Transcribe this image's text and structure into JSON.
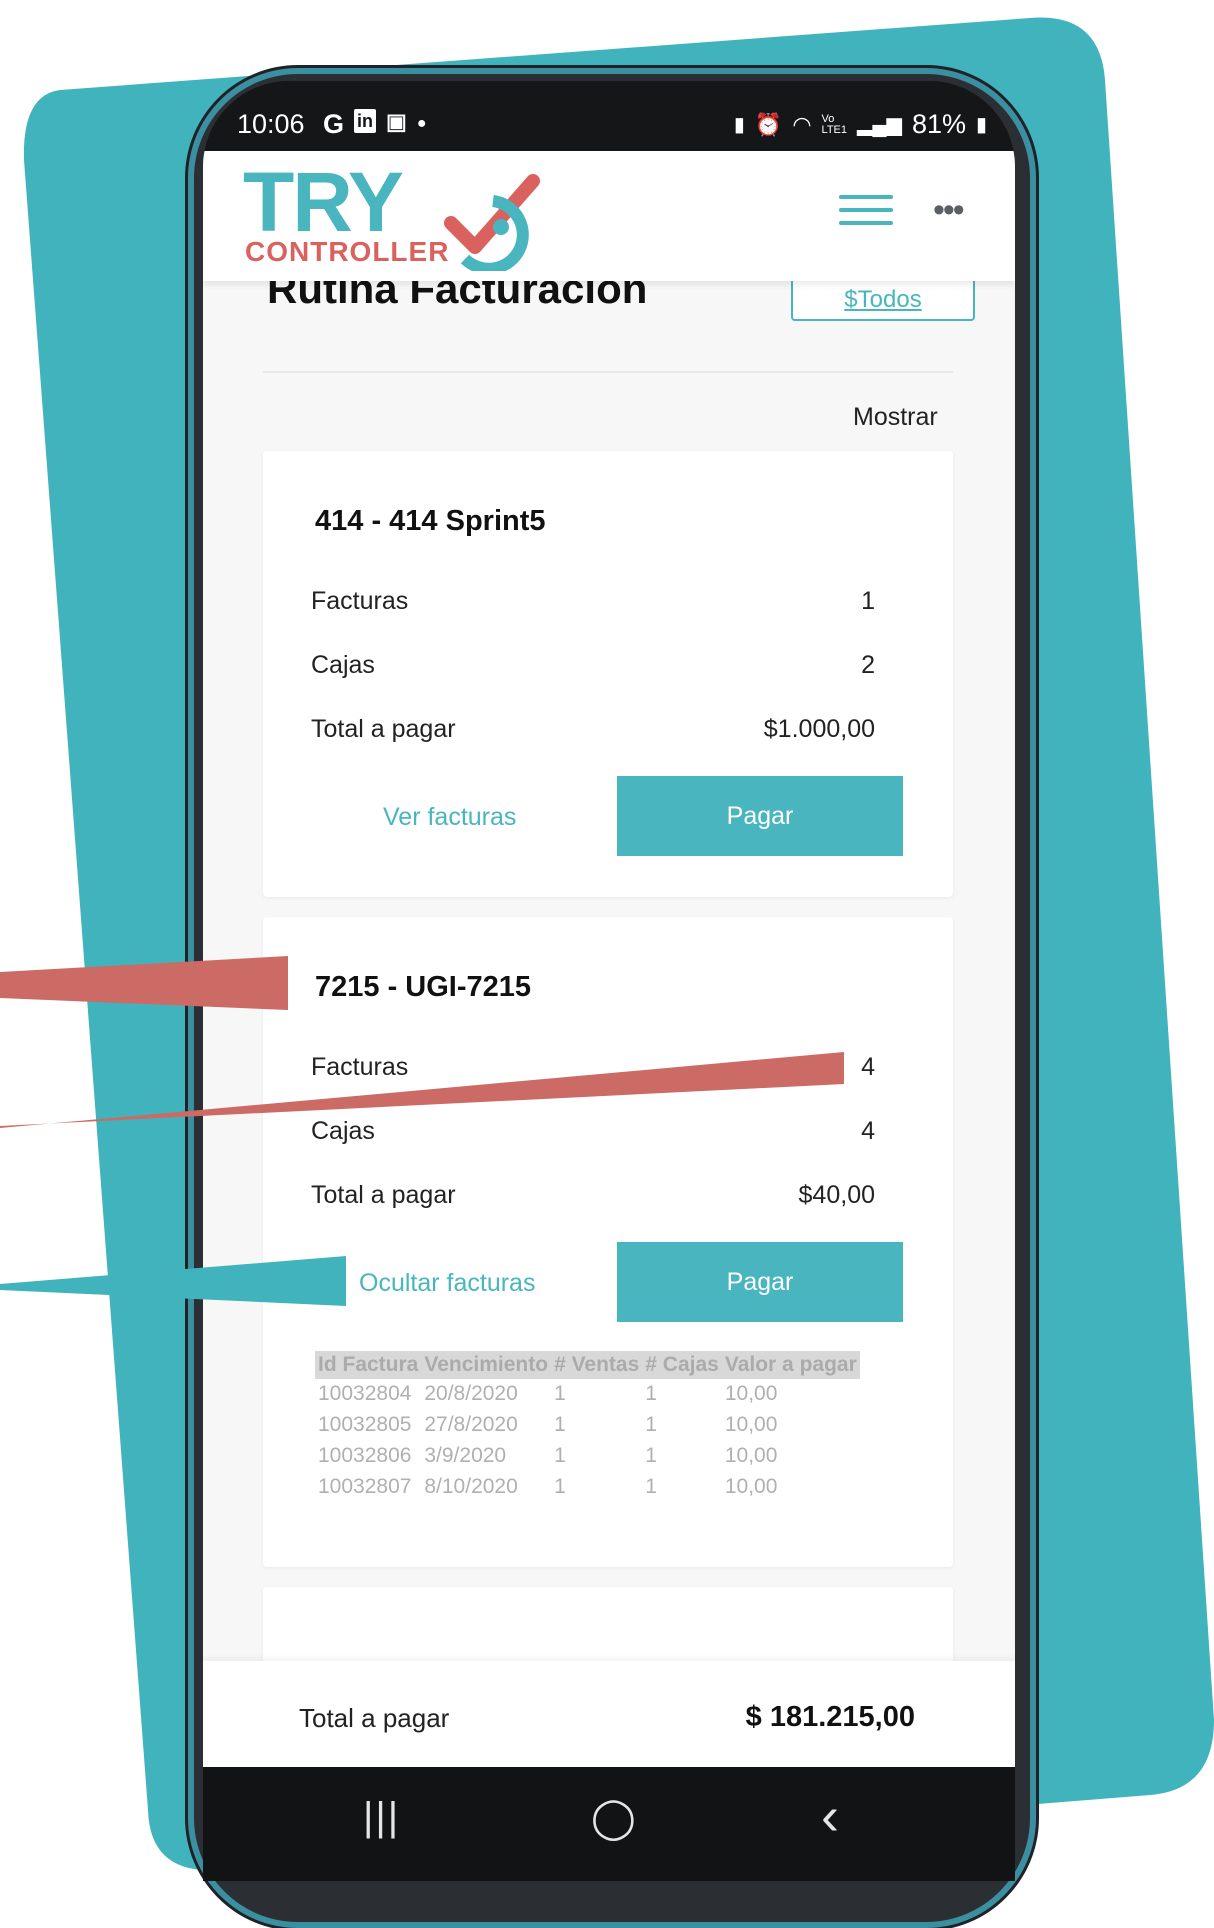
{
  "colors": {
    "teal": "#48b5bf",
    "teal_bg": "#41b3bc",
    "red": "#d9625e",
    "pointer_red": "#cc6a66"
  },
  "status_bar": {
    "time": "10:06",
    "icons_left": [
      "google-icon",
      "linkedin-icon",
      "teams-icon",
      "dot-icon"
    ],
    "icons_right": [
      "battery-saver-icon",
      "alarm-icon",
      "wifi-icon",
      "volte-icon",
      "signal-icon"
    ],
    "battery": "81%"
  },
  "logo": {
    "line1": "TRY",
    "line2": "CONTROLLER"
  },
  "page": {
    "title": "Rutina Facturacion",
    "todos_button": "$Todos",
    "mostrar": "Mostrar"
  },
  "cards": [
    {
      "title": "414 - 414 Sprint5",
      "facturas_label": "Facturas",
      "facturas_value": "1",
      "cajas_label": "Cajas",
      "cajas_value": "2",
      "total_label": "Total a pagar",
      "total_value": "$1.000,00",
      "link": "Ver facturas",
      "pay": "Pagar"
    },
    {
      "title": "7215 - UGI-7215",
      "facturas_label": "Facturas",
      "facturas_value": "4",
      "cajas_label": "Cajas",
      "cajas_value": "4",
      "total_label": "Total a pagar",
      "total_value": "$40,00",
      "link": "Ocultar facturas",
      "pay": "Pagar",
      "table": {
        "headers": [
          "Id Factura",
          "Vencimiento",
          "# Ventas",
          "# Cajas",
          "Valor a pagar"
        ],
        "rows": [
          [
            "10032804",
            "20/8/2020",
            "1",
            "1",
            "10,00"
          ],
          [
            "10032805",
            "27/8/2020",
            "1",
            "1",
            "10,00"
          ],
          [
            "10032806",
            "3/9/2020",
            "1",
            "1",
            "10,00"
          ],
          [
            "10032807",
            "8/10/2020",
            "1",
            "1",
            "10,00"
          ]
        ]
      }
    }
  ],
  "footer": {
    "label": "Total a pagar",
    "value": "$ 181.215,00"
  },
  "nav": {
    "recents": "|||",
    "home": "◯",
    "back": "‹"
  }
}
